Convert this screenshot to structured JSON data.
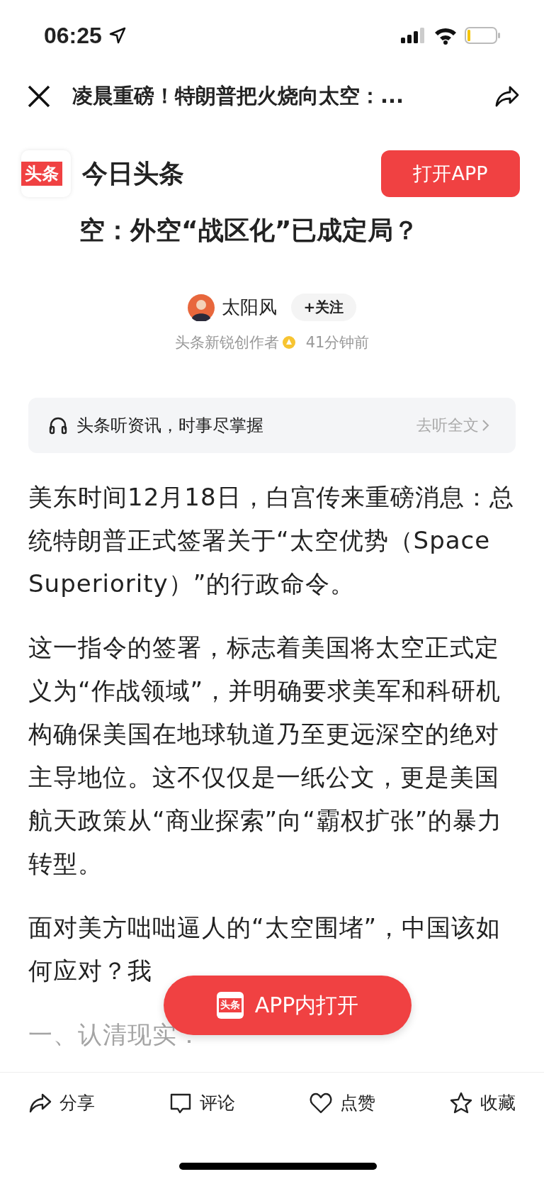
{
  "status_bar": {
    "time": "06:25"
  },
  "nav": {
    "title": "凌晨重磅！特朗普把火烧向太空：..."
  },
  "banner": {
    "logo": "头条",
    "app_name": "今日头条",
    "open_button": "打开APP"
  },
  "article": {
    "title": "空：外空“战区化”已成定局？",
    "author": {
      "name": "太阳风",
      "follow": "+关注",
      "role": "头条新锐创作者",
      "time": "41分钟前"
    },
    "audio": {
      "text": "头条听资讯，时事尽掌握",
      "action": "去听全文"
    },
    "paragraphs": [
      "美东时间12月18日，白宫传来重磅消息：总统特朗普正式签署关于“太空优势（Space Superiority）”的行政命令。",
      "这一指令的签署，标志着美国将太空正式定义为“作战领域”，并明确要求美军和科研机构确保美国在地球轨道乃至更远深空的绝对主导地位。这不仅仅是一纸公文，更是美国航天政策从“商业探索”向“霸权扩张”的暴力转型。",
      "面对美方咄咄逼人的“太空围堵”，中国该如何应对？我"
    ],
    "section_heading": "一、认清现实："
  },
  "float_button": {
    "logo": "头条",
    "label": "APP内打开"
  },
  "toolbar": [
    {
      "kind": "share",
      "label": "分享"
    },
    {
      "kind": "comment",
      "label": "评论"
    },
    {
      "kind": "like",
      "label": "点赞"
    },
    {
      "kind": "collect",
      "label": "收藏"
    }
  ]
}
